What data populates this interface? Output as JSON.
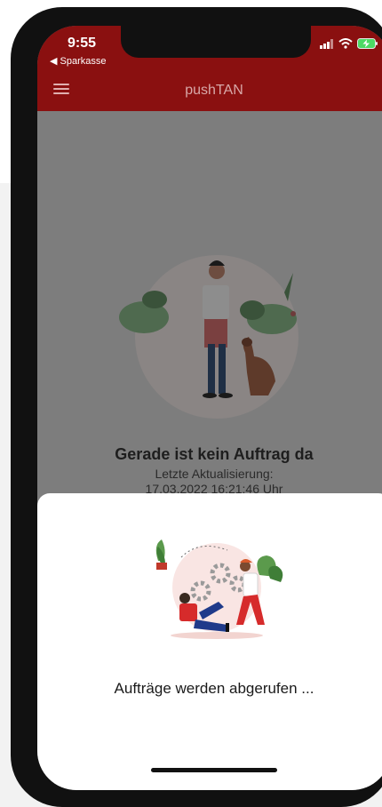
{
  "status_bar": {
    "time": "9:55",
    "back_label": "◀ Sparkasse"
  },
  "app_bar": {
    "title": "pushTAN",
    "menu_icon": "menu-icon"
  },
  "empty_state": {
    "title": "Gerade ist kein Auftrag da",
    "subtitle_line1": "Letzte Aktualisierung:",
    "subtitle_line2": "17.03.2022 16:21:46 Uhr"
  },
  "loading_sheet": {
    "message": "Aufträge werden abgerufen ..."
  },
  "colors": {
    "brand_red": "#8a1010",
    "overlay": "#7d7d7d",
    "sheet": "#ffffff"
  }
}
